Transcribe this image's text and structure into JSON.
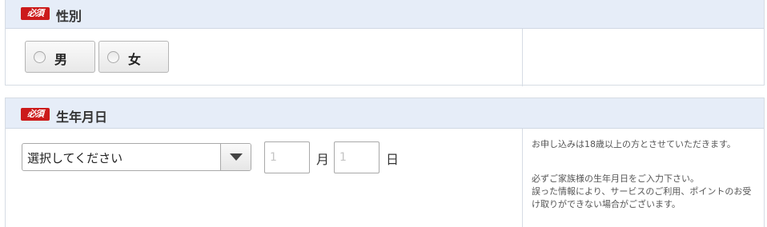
{
  "gender_section": {
    "badge": "必須",
    "title": "性別",
    "options": [
      "男",
      "女"
    ]
  },
  "birth_section": {
    "badge": "必須",
    "title": "生年月日",
    "year_select": {
      "selected": "選択してください"
    },
    "month_input": {
      "placeholder": "1",
      "unit": "月"
    },
    "day_input": {
      "placeholder": "1",
      "unit": "日"
    },
    "note1": "お申し込みは18歳以上の方とさせていただきます。",
    "note2": "必ずご家族様の生年月日をご入力下さい。\n誤った情報により、サービスのご利用、ポイントのお受け取りができない場合がございます。"
  },
  "colors": {
    "required_badge": "#cc1a1a",
    "header_bg": "#e6edf8",
    "border": "#d6dce4"
  },
  "icons": {
    "radio": "radio-circle",
    "select": "triangle-down"
  }
}
